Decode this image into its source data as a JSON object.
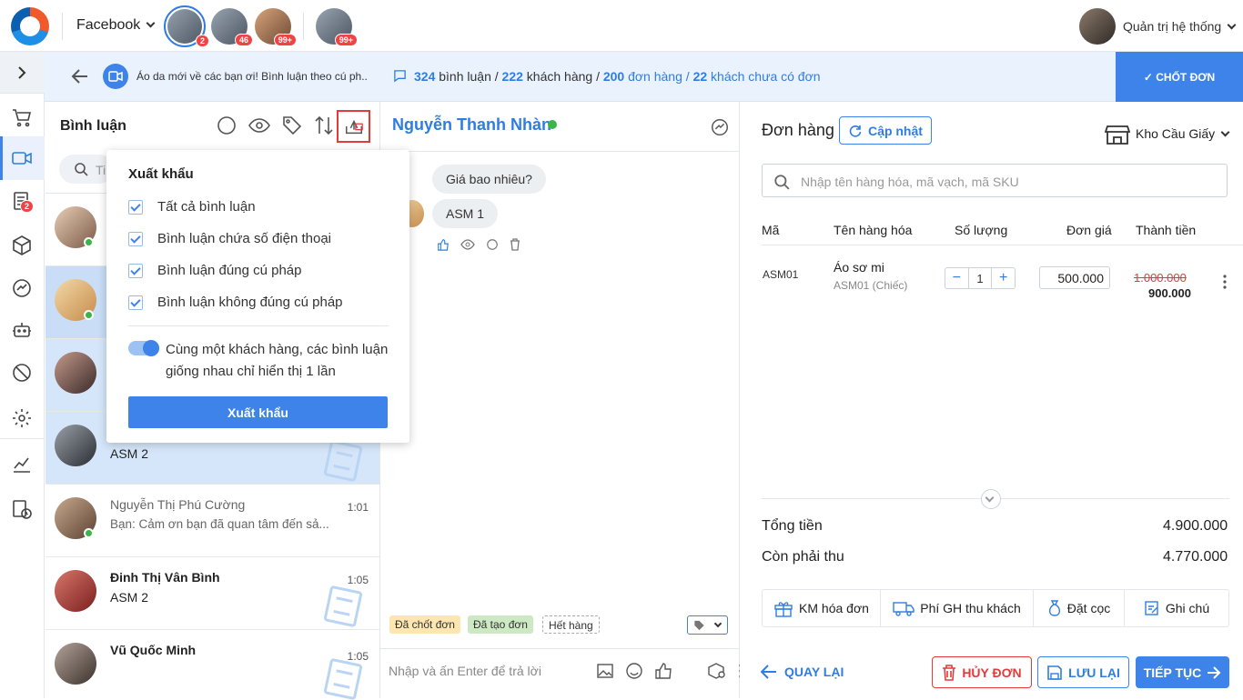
{
  "topbar": {
    "platform": "Facebook",
    "pages": [
      {
        "badge": "2"
      },
      {
        "badge": "46"
      },
      {
        "badge": "99+"
      },
      {
        "badge": "99+"
      }
    ],
    "admin": "Quản trị hệ thống"
  },
  "nav": {
    "post_badge": "2"
  },
  "subbar": {
    "post_title": "Áo da mới về các bạn ơi! Bình luận theo cú ph...",
    "stats": {
      "comments_n": "324",
      "comments_l": "bình luận /",
      "customers_n": "222",
      "customers_l": "khách hàng /",
      "orders_n": "200",
      "orders_l": "đơn hàng /",
      "noorder_n": "22",
      "noorder_l": "khách chưa có đơn"
    },
    "chot_label": "✓ CHỐT ĐƠN"
  },
  "comments": {
    "title": "Bình luận",
    "search_placeholder": "Ti",
    "rows": [
      {
        "name": "",
        "sub": "",
        "time": ""
      },
      {
        "name": "",
        "sub": "",
        "time": ""
      },
      {
        "name": "",
        "sub": "",
        "time": ""
      },
      {
        "name": "",
        "sub": "ASM 2",
        "time": ""
      },
      {
        "name": "Nguyễn Thị Phú Cường",
        "sub": "Bạn: Cảm ơn bạn đã quan tâm đến sả...",
        "time": "1:01"
      },
      {
        "name": "Đinh Thị Vân Bình",
        "sub": "ASM 2",
        "time": "1:05"
      },
      {
        "name": "Vũ Quốc Minh",
        "sub": "",
        "time": "1:05"
      }
    ]
  },
  "export_popup": {
    "title": "Xuất khẩu",
    "options": [
      "Tất cả bình luận",
      "Bình luận chứa số điện thoại",
      "Bình luận đúng cú pháp",
      "Bình luận không đúng cú pháp"
    ],
    "toggle_text": "Cùng một khách hàng, các bình luận giống nhau chỉ hiển thị 1 lần",
    "button": "Xuất khẩu"
  },
  "chat": {
    "customer": "Nguyễn Thanh Nhàn",
    "messages": [
      "Giá bao nhiêu?",
      "ASM 1"
    ],
    "tags": [
      "Đã chốt đơn",
      "Đã tạo đơn",
      "Hết hàng"
    ],
    "reply_placeholder": "Nhập và ấn Enter để trả lời"
  },
  "order": {
    "title": "Đơn hàng",
    "update_label": "Cập nhật",
    "warehouse": "Kho Cầu Giấy",
    "search_placeholder": "Nhập tên hàng hóa, mã vạch, mã SKU",
    "columns": [
      "Mã",
      "Tên hàng hóa",
      "Số lượng",
      "Đơn giá",
      "Thành tiền"
    ],
    "item": {
      "code": "ASM01",
      "name": "Áo sơ mi",
      "sub": "ASM01 (Chiếc)",
      "qty": "1",
      "price": "500.000",
      "old_total": "1.000.000",
      "total": "900.000"
    },
    "total_label": "Tổng tiền",
    "total_value": "4.900.000",
    "remain_label": "Còn phải thu",
    "remain_value": "4.770.000",
    "actions": [
      "KM hóa đơn",
      "Phí GH thu khách",
      "Đặt cọc",
      "Ghi chú"
    ],
    "back": "QUAY LẠI",
    "cancel": "HỦY ĐƠN",
    "save": "LƯU LẠI",
    "next": "TIẾP TỤC"
  }
}
